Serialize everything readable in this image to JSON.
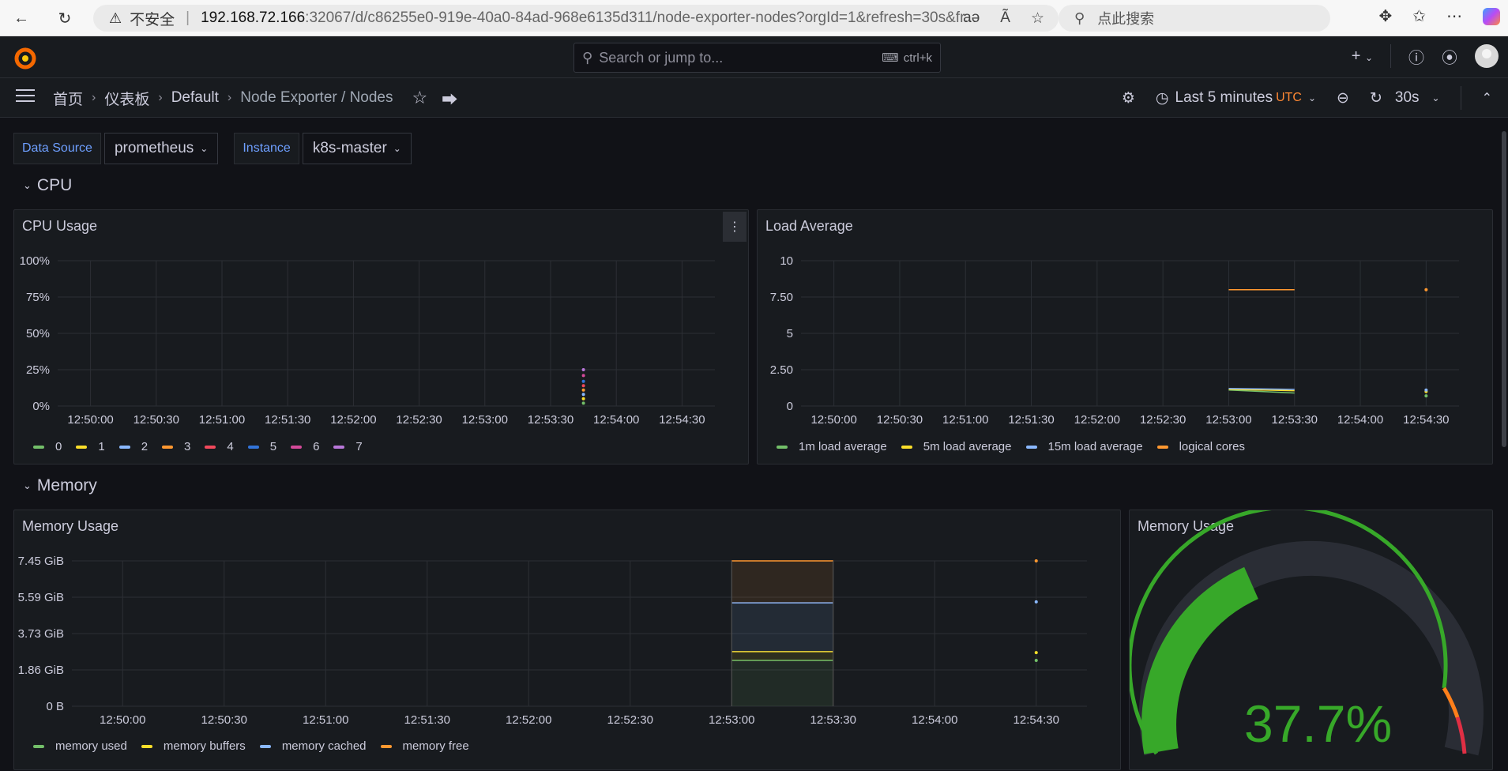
{
  "browser": {
    "insecure_label": "不安全",
    "url_host": "192.168.72.166",
    "url_path": ":32067/d/c86255e0-919e-40a0-84ad-968e6135d311/node-exporter-nodes?orgId=1&refresh=30s&fr...",
    "search_placeholder": "点此搜索"
  },
  "topbar": {
    "search_placeholder": "Search or jump to...",
    "search_shortcut": "ctrl+k"
  },
  "breadcrumb": {
    "home": "首页",
    "dashboards": "仪表板",
    "folder": "Default",
    "dashboard": "Node Exporter / Nodes"
  },
  "toolbar": {
    "time_range": "Last 5 minutes",
    "timezone": "UTC",
    "refresh_interval": "30s"
  },
  "variables": [
    {
      "label": "Data Source",
      "value": "prometheus"
    },
    {
      "label": "Instance",
      "value": "k8s-master"
    }
  ],
  "rows": {
    "cpu": "CPU",
    "memory": "Memory"
  },
  "panels": {
    "cpu_usage": {
      "title": "CPU Usage",
      "y_ticks": [
        "100%",
        "75%",
        "50%",
        "25%",
        "0%"
      ],
      "x_ticks": [
        "12:50:00",
        "12:50:30",
        "12:51:00",
        "12:51:30",
        "12:52:00",
        "12:52:30",
        "12:53:00",
        "12:53:30",
        "12:54:00",
        "12:54:30"
      ],
      "legend": [
        "0",
        "1",
        "2",
        "3",
        "4",
        "5",
        "6",
        "7"
      ]
    },
    "load_average": {
      "title": "Load Average",
      "y_ticks": [
        "10",
        "7.50",
        "5",
        "2.50",
        "0"
      ],
      "x_ticks": [
        "12:50:00",
        "12:50:30",
        "12:51:00",
        "12:51:30",
        "12:52:00",
        "12:52:30",
        "12:53:00",
        "12:53:30",
        "12:54:00",
        "12:54:30"
      ],
      "legend": [
        "1m load average",
        "5m load average",
        "15m load average",
        "logical cores"
      ]
    },
    "memory_usage": {
      "title": "Memory Usage",
      "y_ticks": [
        "7.45 GiB",
        "5.59 GiB",
        "3.73 GiB",
        "1.86 GiB",
        "0 B"
      ],
      "x_ticks": [
        "12:50:00",
        "12:50:30",
        "12:51:00",
        "12:51:30",
        "12:52:00",
        "12:52:30",
        "12:53:00",
        "12:53:30",
        "12:54:00",
        "12:54:30"
      ],
      "legend": [
        "memory used",
        "memory buffers",
        "memory cached",
        "memory free"
      ]
    },
    "memory_gauge": {
      "title": "Memory Usage",
      "value_text": "37.7%"
    }
  },
  "colors": {
    "green": "#73bf69",
    "yellow": "#fade2a",
    "blue": "#5794f2",
    "cyan": "#8ab8ff",
    "orange": "#ff9830",
    "red": "#f2495c",
    "purple": "#b877d9",
    "pink": "#d44a9a",
    "darkblue": "#3274d9",
    "accent": "#6e9fff"
  },
  "chart_data": [
    {
      "type": "line",
      "title": "CPU Usage",
      "x": [
        "12:53:45"
      ],
      "ylim": [
        0,
        100
      ],
      "series": [
        {
          "name": "0",
          "values": [
            2
          ]
        },
        {
          "name": "1",
          "values": [
            5
          ]
        },
        {
          "name": "2",
          "values": [
            8
          ]
        },
        {
          "name": "3",
          "values": [
            11
          ]
        },
        {
          "name": "4",
          "values": [
            14
          ]
        },
        {
          "name": "5",
          "values": [
            17
          ]
        },
        {
          "name": "6",
          "values": [
            21
          ]
        },
        {
          "name": "7",
          "values": [
            25
          ]
        }
      ]
    },
    {
      "type": "line",
      "title": "Load Average",
      "x": [
        "12:53:00",
        "12:53:30",
        "12:54:30"
      ],
      "ylim": [
        0,
        10
      ],
      "series": [
        {
          "name": "1m load average",
          "values": [
            1.1,
            0.9,
            0.7
          ]
        },
        {
          "name": "5m load average",
          "values": [
            1.15,
            1.05,
            1.0
          ]
        },
        {
          "name": "15m load average",
          "values": [
            1.2,
            1.15,
            1.1
          ]
        },
        {
          "name": "logical cores",
          "values": [
            8,
            8,
            8
          ]
        }
      ]
    },
    {
      "type": "area",
      "title": "Memory Usage",
      "x": [
        "12:53:00",
        "12:53:30",
        "12:54:30"
      ],
      "ylim": [
        0,
        7.45
      ],
      "series": [
        {
          "name": "memory used",
          "values": [
            2.35,
            2.35,
            2.35
          ]
        },
        {
          "name": "memory buffers",
          "values": [
            2.8,
            2.8,
            2.75
          ]
        },
        {
          "name": "memory cached",
          "values": [
            5.3,
            5.3,
            5.35
          ]
        },
        {
          "name": "memory free",
          "values": [
            7.45,
            7.45,
            7.45
          ]
        }
      ]
    }
  ]
}
